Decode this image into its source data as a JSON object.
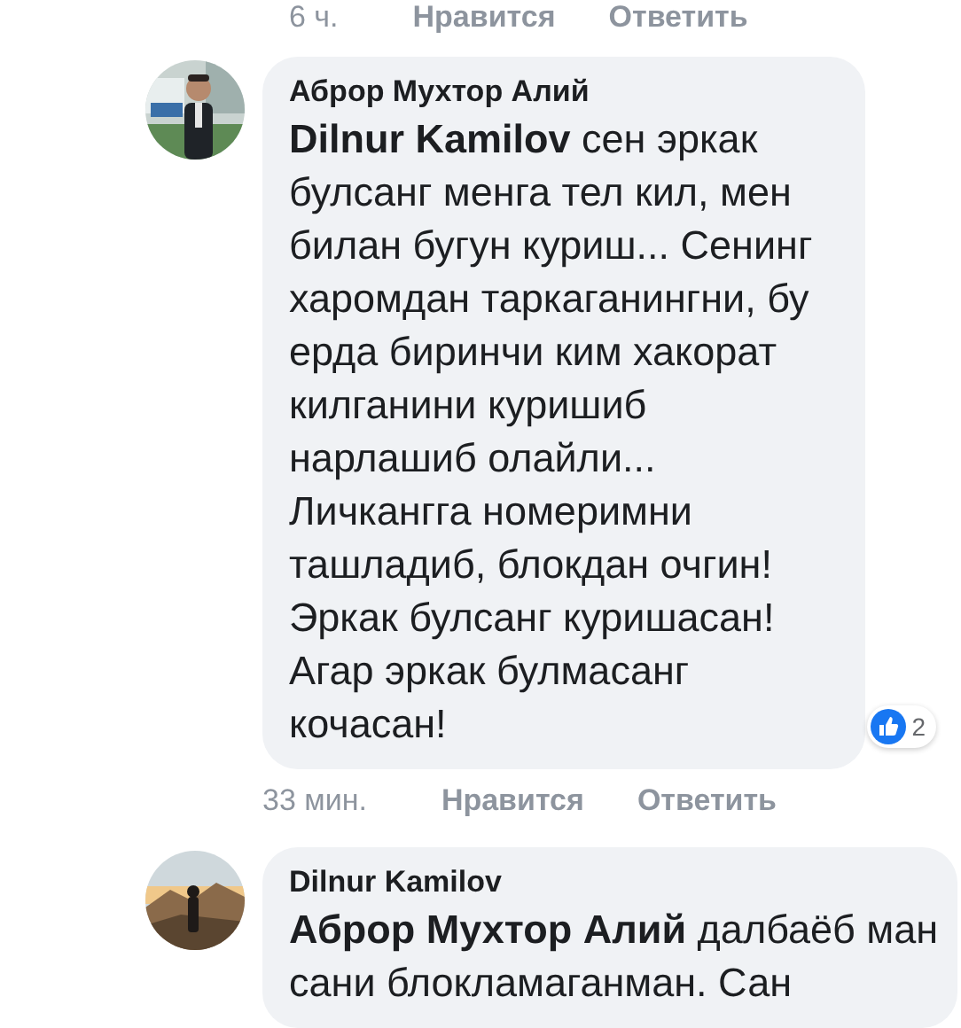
{
  "previous_comment_actions": {
    "time": "6 ч.",
    "like": "Нравится",
    "reply": "Ответить"
  },
  "comments": [
    {
      "author": "Аброр Мухтор Алий",
      "body": "**Dilnur Kamilov** сен эркак булсанг менга тел кил, мен билан бугун куриш... Сенинг харомдан таркаганингни, бу ерда биринчи ким хакорат килганини куришиб нарлашиб олайли... Личкангга номеримни ташладиб, блокдан очгин! Эркак булсанг куришасан! Агар эркак булмасанг кочасан!",
      "reactions": {
        "count": "2"
      },
      "actions": {
        "time": "33 мин.",
        "like": "Нравится",
        "reply": "Ответить"
      }
    },
    {
      "author": "Dilnur Kamilov",
      "body": "**Аброр Мухтор Алий** далбаёб ман сани блокламаганман. Сан"
    }
  ]
}
